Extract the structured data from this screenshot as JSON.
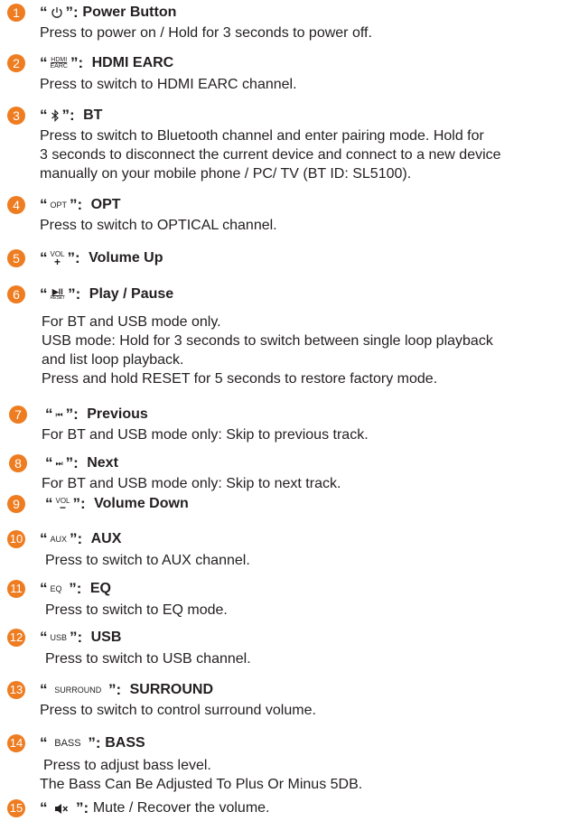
{
  "colors": {
    "badge": "#ee7d22",
    "text": "#231f20"
  },
  "items": [
    {
      "num": "1",
      "symbol": "power-icon",
      "title": "Power Button",
      "desc": [
        "Press to power on / Hold for 3 seconds to power off."
      ]
    },
    {
      "num": "2",
      "symbol_top": "HDMI",
      "symbol_bottom": "EARC",
      "title": "HDMI EARC",
      "desc": [
        "Press to switch to HDMI EARC channel."
      ]
    },
    {
      "num": "3",
      "symbol": "bluetooth-icon",
      "title": "BT",
      "desc": [
        "Press to switch to Bluetooth channel and enter pairing mode. Hold for",
        "3 seconds to disconnect the current device and connect to a new device",
        "manually on your mobile phone / PC/ TV (BT ID: SL5100)."
      ]
    },
    {
      "num": "4",
      "symbol_text": "OPT",
      "title": "OPT",
      "desc": [
        "Press to switch to OPTICAL channel."
      ]
    },
    {
      "num": "5",
      "symbol_top": "VOL",
      "symbol_bottom": "+",
      "title": "Volume Up",
      "desc": []
    },
    {
      "num": "6",
      "symbol_top": "▶II",
      "symbol_bottom": "RESET",
      "title": "Play / Pause",
      "desc": [
        "For BT and USB mode only.",
        "USB mode: Hold for 3 seconds to switch between single loop playback",
        "and list loop playback.",
        "Press and hold RESET for 5 seconds to restore factory mode."
      ]
    },
    {
      "num": "7",
      "symbol": "previous-icon",
      "title": "Previous",
      "desc": [
        "For BT and USB mode only: Skip to previous track."
      ]
    },
    {
      "num": "8",
      "symbol": "next-icon",
      "title": "Next",
      "desc": [
        "For BT and USB mode only: Skip to next track."
      ]
    },
    {
      "num": "9",
      "symbol_top": "VOL",
      "symbol_bottom": "−",
      "title": "Volume Down",
      "desc": []
    },
    {
      "num": "10",
      "symbol_text": "AUX",
      "title": "AUX",
      "desc": [
        "Press to switch to AUX channel."
      ]
    },
    {
      "num": "11",
      "symbol_text": "EQ",
      "title": "EQ",
      "desc": [
        "Press to switch to EQ mode."
      ]
    },
    {
      "num": "12",
      "symbol_text": "USB",
      "title": "USB",
      "desc": [
        "Press to switch to USB channel."
      ]
    },
    {
      "num": "13",
      "symbol_text": "SURROUND",
      "title": "SURROUND",
      "desc": [
        "Press to switch to control surround volume."
      ]
    },
    {
      "num": "14",
      "symbol_text": "BASS",
      "title": "BASS",
      "desc": [
        "Press to adjust bass level.",
        "The Bass Can Be Adjusted To Plus Or Minus 5DB."
      ]
    },
    {
      "num": "15",
      "symbol": "mute-icon",
      "title": "Mute / Recover the volume.",
      "desc": []
    }
  ]
}
